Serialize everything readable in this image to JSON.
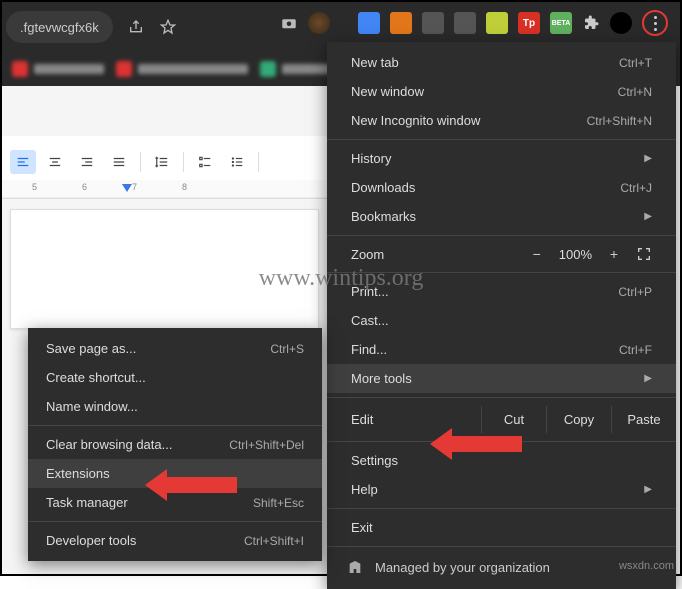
{
  "url_fragment": ".fgtevwcgfx6k",
  "main_menu": {
    "new_tab": "New tab",
    "new_tab_sc": "Ctrl+T",
    "new_window": "New window",
    "new_window_sc": "Ctrl+N",
    "incognito": "New Incognito window",
    "incognito_sc": "Ctrl+Shift+N",
    "history": "History",
    "downloads": "Downloads",
    "downloads_sc": "Ctrl+J",
    "bookmarks": "Bookmarks",
    "zoom_label": "Zoom",
    "zoom_value": "100%",
    "print": "Print...",
    "print_sc": "Ctrl+P",
    "cast": "Cast...",
    "find": "Find...",
    "find_sc": "Ctrl+F",
    "more_tools": "More tools",
    "edit": "Edit",
    "cut": "Cut",
    "copy": "Copy",
    "paste": "Paste",
    "settings": "Settings",
    "help": "Help",
    "exit": "Exit",
    "managed": "Managed by your organization"
  },
  "submenu": {
    "save_page": "Save page as...",
    "save_page_sc": "Ctrl+S",
    "create_shortcut": "Create shortcut...",
    "name_window": "Name window...",
    "clear_data": "Clear browsing data...",
    "clear_data_sc": "Ctrl+Shift+Del",
    "extensions": "Extensions",
    "task_manager": "Task manager",
    "task_manager_sc": "Shift+Esc",
    "dev_tools": "Developer tools",
    "dev_tools_sc": "Ctrl+Shift+I"
  },
  "ruler": {
    "n5": "5",
    "n6": "6",
    "n7": "7",
    "n8": "8"
  },
  "watermark_center": "www.wintips.org",
  "watermark_corner": "wsxdn.com"
}
